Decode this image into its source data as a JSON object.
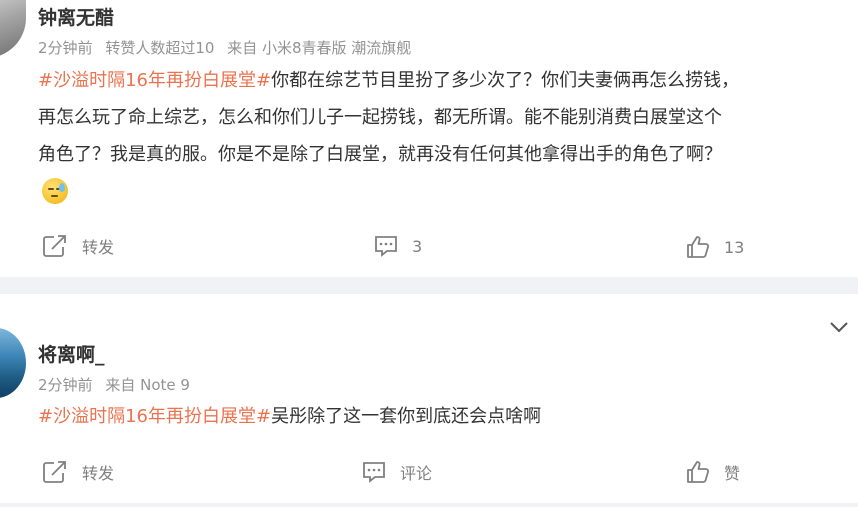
{
  "posts": [
    {
      "username": "钟离无醋",
      "meta": [
        "2分钟前",
        "转赞人数超过10",
        "来自 小米8青春版 潮流旗舰"
      ],
      "topic": "#沙溢时隔16年再扮白展堂#",
      "lines": [
        "你都在综艺节目里扮了多少次了？你们夫妻俩再怎么捞钱，",
        "再怎么玩了命上综艺，怎么和你们儿子一起捞钱，都无所谓。能不能别消费白展堂这个",
        "角色了？我是真的服。你是不是除了白展堂，就再没有任何其他拿得出手的角色了啊？"
      ],
      "actions": {
        "repost": "转发",
        "comment": "3",
        "like": "13"
      }
    },
    {
      "username": "将离啊_",
      "meta": [
        "2分钟前",
        "来自 Note 9"
      ],
      "topic": "#沙溢时隔16年再扮白展堂#",
      "lines": [
        "吴彤除了这一套你到底还会点啥啊"
      ],
      "actions": {
        "repost": "转发",
        "comment": "评论",
        "like": "赞"
      }
    }
  ],
  "icons": {
    "repost": "repost-icon",
    "comment": "comment-icon",
    "like": "thumbs-up-icon",
    "emoji": "sweat-emoji-icon",
    "collapse": "chevron-down-icon"
  },
  "colors": {
    "topic": "#eb7350",
    "meta": "#939393",
    "text": "#333333",
    "separator": "#f1f2f5"
  }
}
